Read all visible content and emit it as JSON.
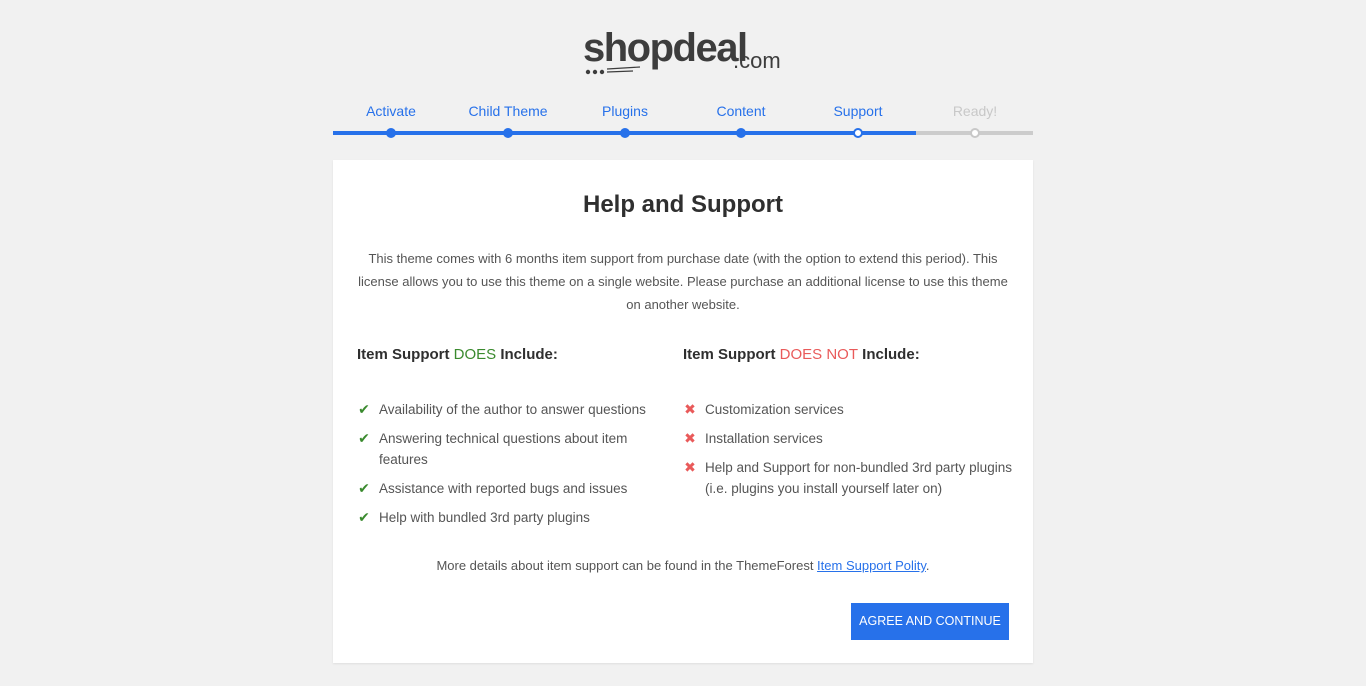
{
  "logo": {
    "main": "shopdeal",
    "tld": ".com"
  },
  "steps": [
    {
      "label": "Activate",
      "state": "done"
    },
    {
      "label": "Child Theme",
      "state": "done"
    },
    {
      "label": "Plugins",
      "state": "done"
    },
    {
      "label": "Content",
      "state": "done"
    },
    {
      "label": "Support",
      "state": "active"
    },
    {
      "label": "Ready!",
      "state": "pending"
    }
  ],
  "card": {
    "title": "Help and Support",
    "intro": "This theme comes with 6 months item support from purchase date (with the option to extend this period). This license allows you to use this theme on a single website. Please purchase an additional license to use this theme on another website.",
    "includes": {
      "heading_prefix": "Item Support ",
      "heading_highlight": "DOES",
      "heading_suffix": " Include:",
      "items": [
        "Availability of the author to answer questions",
        "Answering technical questions about item features",
        "Assistance with reported bugs and issues",
        "Help with bundled 3rd party plugins"
      ]
    },
    "excludes": {
      "heading_prefix": "Item Support ",
      "heading_highlight": "DOES NOT",
      "heading_suffix": " Include:",
      "items": [
        "Customization services",
        "Installation services",
        "Help and Support for non-bundled 3rd party plugins (i.e. plugins you install yourself later on)"
      ]
    },
    "footnote_text": "More details about item support can be found in the ThemeForest ",
    "footnote_link": "Item Support Polity",
    "footnote_end": ".",
    "agree_button": "AGREE AND CONTINUE"
  },
  "icons": {
    "check": "check-icon",
    "cross": "cross-icon"
  },
  "colors": {
    "accent": "#2771ea",
    "does": "#3a8a2e",
    "does_not": "#e95a5a",
    "pending": "#c8c8c8"
  }
}
